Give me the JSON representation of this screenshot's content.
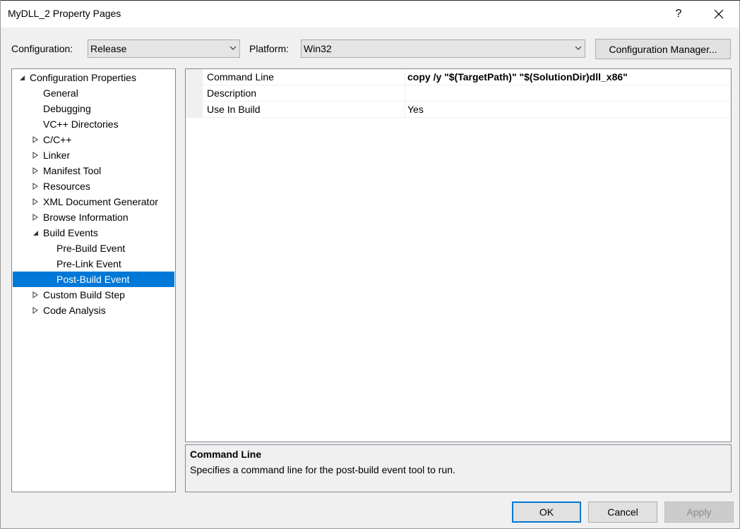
{
  "window": {
    "title": "MyDLL_2 Property Pages",
    "help_label": "?"
  },
  "config_bar": {
    "configuration_label": "Configuration:",
    "configuration_value": "Release",
    "platform_label": "Platform:",
    "platform_value": "Win32",
    "manager_button": "Configuration Manager..."
  },
  "tree": {
    "root": "Configuration Properties",
    "items": [
      {
        "label": "General",
        "expander": "none"
      },
      {
        "label": "Debugging",
        "expander": "none"
      },
      {
        "label": "VC++ Directories",
        "expander": "none"
      },
      {
        "label": "C/C++",
        "expander": "collapsed"
      },
      {
        "label": "Linker",
        "expander": "collapsed"
      },
      {
        "label": "Manifest Tool",
        "expander": "collapsed"
      },
      {
        "label": "Resources",
        "expander": "collapsed"
      },
      {
        "label": "XML Document Generator",
        "expander": "collapsed"
      },
      {
        "label": "Browse Information",
        "expander": "collapsed"
      },
      {
        "label": "Build Events",
        "expander": "expanded"
      }
    ],
    "build_events_children": [
      {
        "label": "Pre-Build Event",
        "selected": false
      },
      {
        "label": "Pre-Link Event",
        "selected": false
      },
      {
        "label": "Post-Build Event",
        "selected": true
      }
    ],
    "after_items": [
      {
        "label": "Custom Build Step",
        "expander": "collapsed"
      },
      {
        "label": "Code Analysis",
        "expander": "collapsed"
      }
    ]
  },
  "properties": [
    {
      "name": "Command Line",
      "value": "copy /y \"$(TargetPath)\" \"$(SolutionDir)dll_x86\"",
      "bold": true
    },
    {
      "name": "Description",
      "value": "",
      "bold": false
    },
    {
      "name": "Use In Build",
      "value": "Yes",
      "bold": false
    }
  ],
  "description_panel": {
    "title": "Command Line",
    "text": "Specifies a command line for the post-build event tool to run."
  },
  "buttons": {
    "ok": "OK",
    "cancel": "Cancel",
    "apply": "Apply"
  },
  "colors": {
    "selection": "#0078d7",
    "background": "#f0f0f0"
  }
}
